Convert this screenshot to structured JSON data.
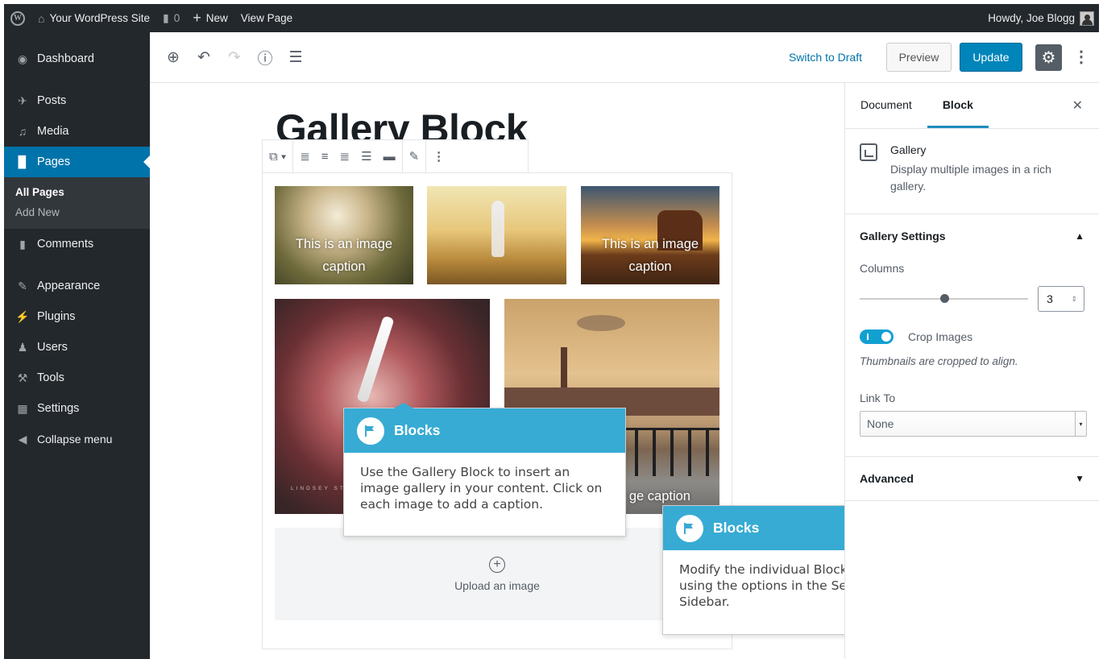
{
  "adminbar": {
    "site_name": "Your WordPress Site",
    "comments_count": "0",
    "new_label": "New",
    "view_page_label": "View Page",
    "greeting": "Howdy, Joe Blogg"
  },
  "sidebar": {
    "items": [
      {
        "label": "Dashboard",
        "icon": "dashboard-icon"
      },
      {
        "label": "Posts",
        "icon": "pin-icon"
      },
      {
        "label": "Media",
        "icon": "media-icon"
      },
      {
        "label": "Pages",
        "icon": "pages-icon"
      },
      {
        "label": "Comments",
        "icon": "comment-icon"
      },
      {
        "label": "Appearance",
        "icon": "brush-icon"
      },
      {
        "label": "Plugins",
        "icon": "plugin-icon"
      },
      {
        "label": "Users",
        "icon": "users-icon"
      },
      {
        "label": "Tools",
        "icon": "wrench-icon"
      },
      {
        "label": "Settings",
        "icon": "settings-icon"
      },
      {
        "label": "Collapse menu",
        "icon": "collapse-icon"
      }
    ],
    "submenu": [
      "All Pages",
      "Add New"
    ]
  },
  "editor": {
    "switch_to_draft": "Switch to Draft",
    "preview": "Preview",
    "update": "Update",
    "title": "Gallery Block",
    "images": [
      {
        "caption": "This is an image caption"
      },
      {
        "caption": ""
      },
      {
        "caption": "This is an image caption"
      },
      {
        "caption": "",
        "signature": "LINDSEY STIRLING · BRAVE ENOUGH"
      },
      {
        "caption": "ge caption"
      }
    ],
    "upload_label": "Upload an image"
  },
  "tooltips": [
    {
      "title": "Blocks",
      "body": "Use the Gallery Block to insert an image gallery in your content. Click on each image to add a caption."
    },
    {
      "title": "Blocks",
      "body": "Modify the individual Block Settings using the options in the Settings Sidebar."
    }
  ],
  "settings": {
    "tabs": [
      "Document",
      "Block"
    ],
    "block_name": "Gallery",
    "block_desc": "Display multiple images in a rich gallery.",
    "gallery_settings": "Gallery Settings",
    "columns_label": "Columns",
    "columns_value": "3",
    "columns_level": 0.5,
    "crop_label": "Crop Images",
    "crop_help": "Thumbnails are cropped to align.",
    "link_to_label": "Link To",
    "link_to_value": "None",
    "advanced": "Advanced"
  },
  "colors": {
    "admin_dark": "#23282d",
    "accent": "#0073aa",
    "update_button": "#0085ba",
    "tooltip_header": "#37abd3"
  }
}
